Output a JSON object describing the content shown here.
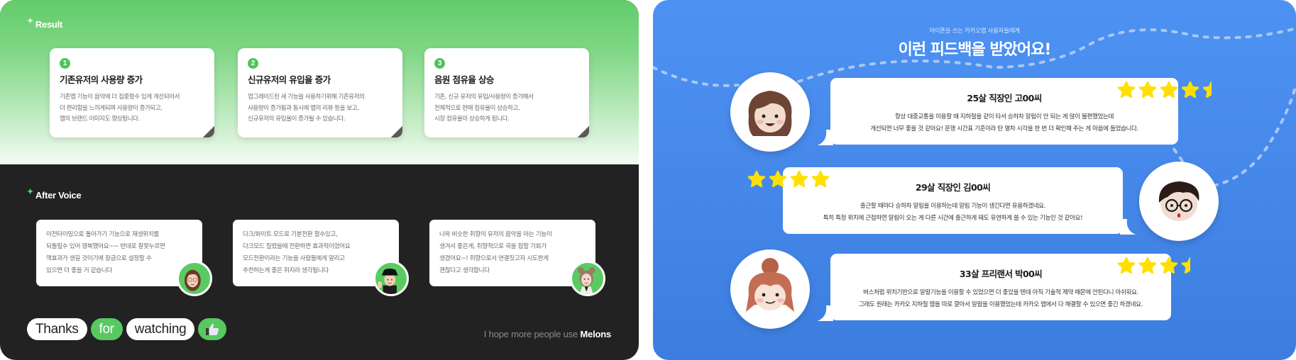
{
  "result": {
    "title": "Result",
    "sparkle_icon": "sparkle-icon",
    "cards": [
      {
        "number": "1",
        "heading": "기존유저의 사용량 증가",
        "body": "기존앱 기능이 음악에 더 집중할수 있게 개선되어서\n더 편리함을 느끼게되며 사용량이 증가되고,\n앱의 브랜드 이미지도 향상됩니다."
      },
      {
        "number": "2",
        "heading": "신규유저의 유입율 증가",
        "body": "업그레이드된 새 기능을 사용하기위해 기존유저의\n사용량이 증가됨과 동시에 앱의 리뷰 등을 보고,\n신규유저의 유입율이 증가될 수 있습니다."
      },
      {
        "number": "3",
        "heading": "음원 점유율 상승",
        "body": "기존, 신규 유저의 유입/사용량이 증가해서\n전체적으로 판매 점유율이 상승하고,\n시장 점유율이 상승하게 됩니다."
      }
    ]
  },
  "after_voice": {
    "title": "After Voice",
    "cards": [
      {
        "text": "이전타이밍으로 돌아가기 기능으로 재생위치를\n되돌릴수 있어 행복했어요~~ 반대로 잘못누르면\n역효과가 생길 것이기에 잠금으로 설정할 수\n있으면 더 좋을 거 같습니다",
        "avatar": "woman-glasses-avatar"
      },
      {
        "text": "다크/화이트 모드로 기분전환 할수있고,\n다크모드 질렸을때 전환하면 효과적이었어요\n모드전환이라는 기능을 사람들에게 알리고\n추천하는게 좋은 취지라 생각됩니다",
        "avatar": "man-bucket-hat-avatar"
      },
      {
        "text": "나와 비슷한 취향의 유저의 음악을 아는 기능이\n생겨서 좋은게, 취향적으로 곡을 접할 기회가\n생겼어요~! 취향으로서 연결짓고자 시도한게\n괜찮다고 생각합니다",
        "avatar": "woman-buns-avatar"
      }
    ]
  },
  "thanks": {
    "words": [
      "Thanks",
      "for",
      "watching"
    ],
    "thumb_icon": "thumbs-up-icon"
  },
  "footer": {
    "prefix": "I hope more people use ",
    "brand": "Melons"
  },
  "feedback": {
    "subtitle": "아이폰을 쓰는 카카오맵 사용자들에게",
    "title": "이런 피드백을 받았어요!",
    "colors": {
      "star": "#ffe000",
      "background": "#4688ea"
    },
    "reviews": [
      {
        "reviewer": "25살 직장인 고00씨",
        "text": "항상 대중교통을 이용할 때 지하철을 같이 타서 승하차 알림이 안 되는 게 많이 불편했었는데\n개선되면 너무 좋을 것 같아요! 운행 시간표 기준이라 탄 열차 시각을 한 번 더 확인해 주는 게 마음에 들었습니다.",
        "rating": 4.5,
        "avatar": "long-hair-woman-avatar"
      },
      {
        "reviewer": "29살 직장인 김00씨",
        "text": "출근할 때마다 승하차 알림을 이용하는데 알림 기능이 생긴다면 유용하겠네요.\n특히 특정 위치에 근접하면 알림이 오는 게 다른 시간에 출근하게 돼도 유연하게 쓸 수 있는 기능인 것 같아요!",
        "rating": 4,
        "avatar": "glasses-man-avatar"
      },
      {
        "reviewer": "33살 프리랜서 박00씨",
        "text": "버스처럼 위치기반으로 알람기능을 이용할 수 있었으면 더 좋았을 텐데 아직 기술적 제약 때문에 안된다니 아쉬워요.\n그래도 원래는 카카오 지하철 앱을 따로 깔아서 알람을 이용했었는데 카카오 맵에서 다 해결할 수 있으면 좋긴 하겠네요.",
        "rating": 3.5,
        "avatar": "bun-hair-woman-avatar"
      }
    ]
  }
}
